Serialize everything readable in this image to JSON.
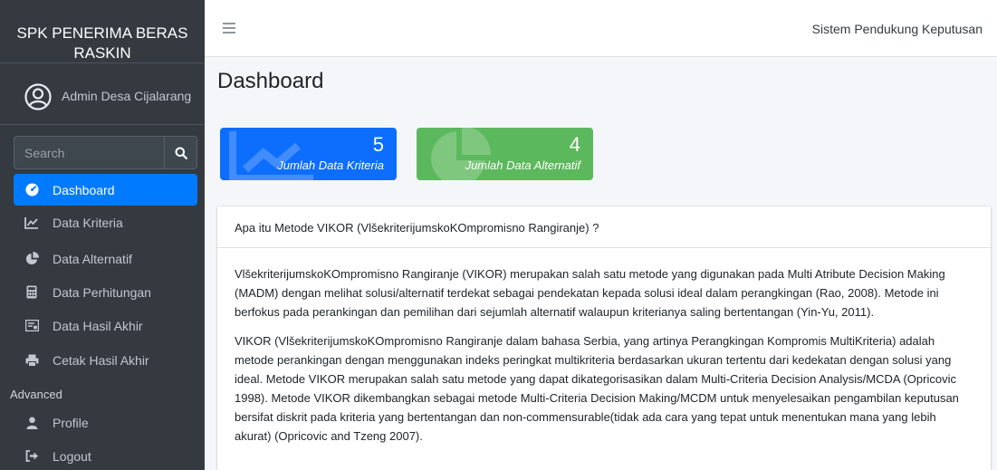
{
  "sidebar": {
    "brand_line1": "SPK PENERIMA BERAS",
    "brand_line2": "RASKIN",
    "user_name": "Admin Desa Cijalarang",
    "search_placeholder": "Search",
    "items": [
      {
        "label": "Dashboard",
        "icon": "dashboard-icon",
        "active": true
      },
      {
        "label": "Data Kriteria",
        "icon": "chart-line-icon",
        "active": false
      },
      {
        "label": "Data Alternatif",
        "icon": "chart-pie-icon",
        "active": false
      },
      {
        "label": "Data Perhitungan",
        "icon": "calculator-icon",
        "active": false
      },
      {
        "label": "Data Hasil Akhir",
        "icon": "certificate-icon",
        "active": false
      },
      {
        "label": "Cetak Hasil Akhir",
        "icon": "print-icon",
        "active": false
      }
    ],
    "section_header": "Advanced",
    "advanced_items": [
      {
        "label": "Profile",
        "icon": "user-icon"
      },
      {
        "label": "Logout",
        "icon": "logout-icon"
      }
    ]
  },
  "topbar": {
    "title": "Sistem Pendukung Keputusan"
  },
  "main": {
    "page_title": "Dashboard",
    "info_boxes": [
      {
        "value": "5",
        "label": "Jumlah Data Kriteria",
        "color": "#0d6efd",
        "icon": "chart-line-icon"
      },
      {
        "value": "4",
        "label": "Jumlah Data Alternatif",
        "color": "#5cb85c",
        "icon": "chart-pie-icon"
      }
    ],
    "card": {
      "header": "Apa itu Metode VIKOR (VlšekriterijumskoKOmpromisno Rangiranje) ?",
      "paragraphs": [
        "VlšekriterijumskoKOmpromisno Rangiranje (VIKOR) merupakan salah satu metode yang digunakan pada Multi Atribute Decision Making (MADM) dengan melihat solusi/alternatif terdekat sebagai pendekatan kepada solusi ideal dalam perangkingan (Rao, 2008). Metode ini berfokus pada perankingan dan pemilihan dari sejumlah alternatif walaupun kriterianya saling bertentangan (Yin-Yu, 2011).",
        "VIKOR (VlšekriterijumskoKOmpromisno Rangiranje dalam bahasa Serbia, yang artinya Perangkingan Kompromis MultiKriteria) adalah metode perankingan dengan menggunakan indeks peringkat multikriteria berdasarkan ukuran tertentu dari kedekatan dengan solusi yang ideal. Metode VIKOR merupakan salah satu metode yang dapat dikategorisasikan dalam Multi-Criteria Decision Analysis/MCDA (Opricovic 1998). Metode VIKOR dikembangkan sebagai metode Multi-Criteria Decision Making/MCDM untuk menyelesaikan pengambilan keputusan bersifat diskrit pada kriteria yang bertentangan dan non-commensurable(tidak ada cara yang tepat untuk menentukan mana yang lebih akurat) (Opricovic and Tzeng 2007)."
      ]
    }
  }
}
